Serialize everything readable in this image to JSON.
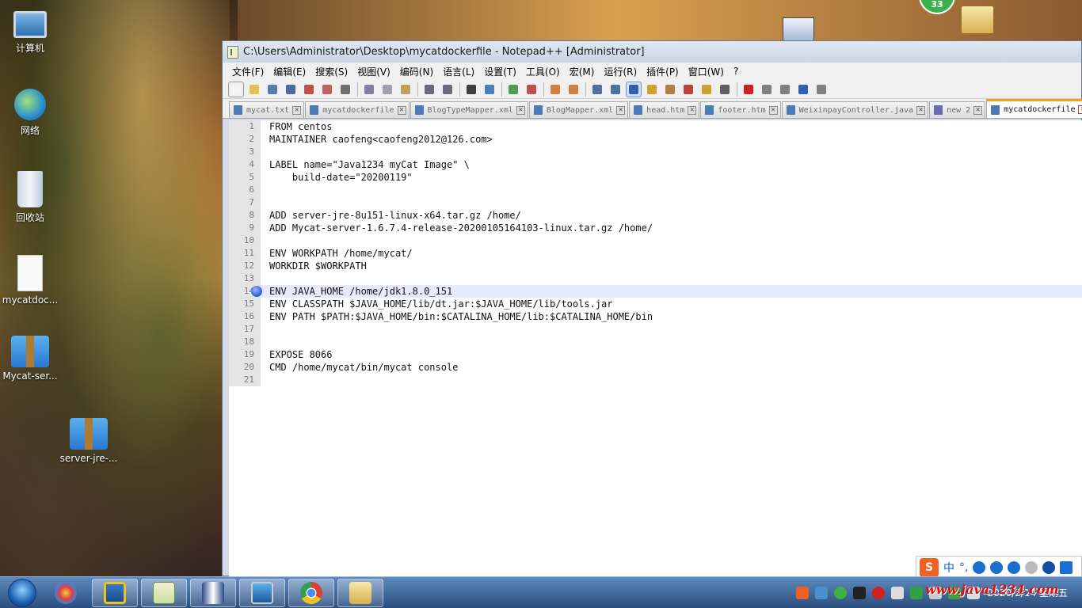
{
  "desktop": {
    "icons": [
      {
        "label": "计算机"
      },
      {
        "label": "网络"
      },
      {
        "label": "回收站"
      },
      {
        "label": "mycatdoc..."
      },
      {
        "label": "Mycat-ser..."
      },
      {
        "label": "server-jre-..."
      }
    ],
    "badge": "33"
  },
  "window": {
    "title": "C:\\Users\\Administrator\\Desktop\\mycatdockerfile - Notepad++ [Administrator]"
  },
  "menu": [
    "文件(F)",
    "编辑(E)",
    "搜索(S)",
    "视图(V)",
    "编码(N)",
    "语言(L)",
    "设置(T)",
    "工具(O)",
    "宏(M)",
    "运行(R)",
    "插件(P)",
    "窗口(W)",
    "?"
  ],
  "tabs": [
    {
      "label": "mycat.txt",
      "active": false
    },
    {
      "label": "mycatdockerfile",
      "active": false
    },
    {
      "label": "BlogTypeMapper.xml",
      "active": false
    },
    {
      "label": "BlogMapper.xml",
      "active": false
    },
    {
      "label": "head.htm",
      "active": false
    },
    {
      "label": "footer.htm",
      "active": false
    },
    {
      "label": "WeixinpayController.java",
      "active": false
    },
    {
      "label": "new 2",
      "active": false
    },
    {
      "label": "mycatdockerfile",
      "active": true
    }
  ],
  "editor": {
    "current_line": 14,
    "bookmark_line": 14,
    "lines": [
      "FROM centos",
      "MAINTAINER caofeng<caofeng2012@126.com>",
      "",
      "LABEL name=\"Java1234 myCat Image\" \\",
      "    build-date=\"20200119\"",
      "",
      "",
      "ADD server-jre-8u151-linux-x64.tar.gz /home/",
      "ADD Mycat-server-1.6.7.4-release-20200105164103-linux.tar.gz /home/",
      "",
      "ENV WORKPATH /home/mycat/",
      "WORKDIR $WORKPATH",
      "",
      "ENV JAVA_HOME /home/jdk1.8.0_151",
      "ENV CLASSPATH $JAVA_HOME/lib/dt.jar:$JAVA_HOME/lib/tools.jar",
      "ENV PATH $PATH:$JAVA_HOME/bin:$CATALINA_HOME/lib:$CATALINA_HOME/bin",
      "",
      "",
      "EXPOSE 8066",
      "CMD /home/mycat/bin/mycat console",
      ""
    ]
  },
  "ime": {
    "logo": "S",
    "mode": "中",
    "punct": "°,"
  },
  "taskbar": {
    "clock_time": "",
    "clock_date": "2020/2/14 星期五"
  },
  "watermark": "www.java1234.com",
  "colors": {
    "accent_tab": "#f0a020",
    "current_line_bg": "#e8e8ff",
    "bookmark": "#2a58d0"
  }
}
